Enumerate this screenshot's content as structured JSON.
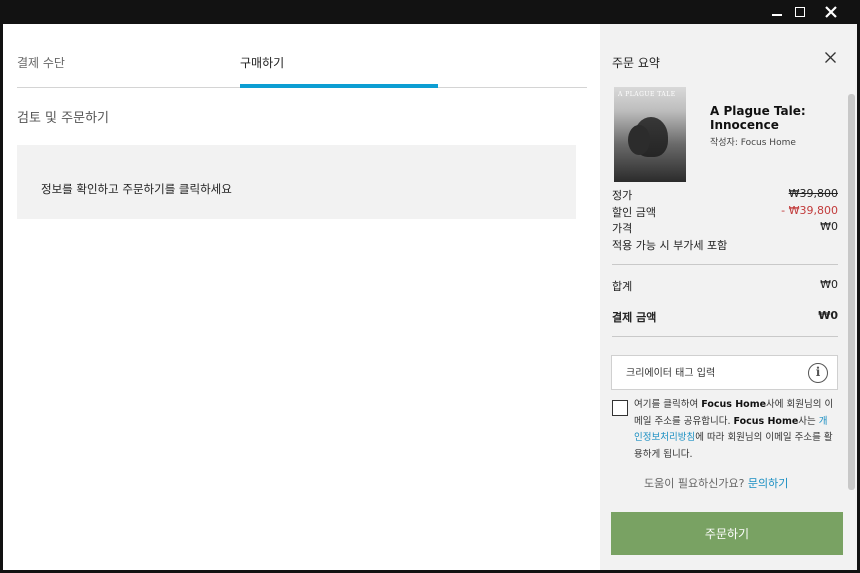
{
  "window": {
    "minimize_label": "—",
    "maximize_label": "□",
    "close_label": "✕"
  },
  "tabs": [
    {
      "label": "결제 수단"
    },
    {
      "label": "구매하기"
    }
  ],
  "review": {
    "title": "검토 및 주문하기",
    "notice": "정보를 확인하고 주문하기를 클릭하세요"
  },
  "summary": {
    "title": "주문 요약",
    "close_icon": "close-icon",
    "cover_text": "A PLAGUE TALE",
    "game_title": "A Plague Tale: Innocence",
    "publisher": "작성자: Focus Home",
    "price_label": "정가",
    "price_value": "₩39,800",
    "discount_label": "할인 금액",
    "discount_value": "- ₩39,800",
    "final_label": "가격",
    "final_value": "₩0",
    "tax_note": "적용 가능 시 부가세 포함",
    "total_label": "합계",
    "total_value": "₩0",
    "pay_label": "결제 금액",
    "pay_value": "₩0",
    "creator_tag_placeholder": "크리에이터 태그 입력",
    "info_icon": "i",
    "consent_p1": "여기를 클릭하여 ",
    "consent_b1": "Focus Home",
    "consent_p2": "사에 회원님의 이메일 주소를 공유합니다. ",
    "consent_b2": "Focus Home",
    "consent_p3": "사는 ",
    "consent_link": "개인정보처리방침",
    "consent_p4": "에 따라 회원님의 이메일 주소를 활용하게 됩니다.",
    "help_text": "도움이 필요하신가요? ",
    "help_link": "문의하기",
    "order_button": "주문하기"
  },
  "colors": {
    "accent": "#0d9ed3",
    "order_button": "#79a263",
    "discount": "#c23b3b"
  }
}
